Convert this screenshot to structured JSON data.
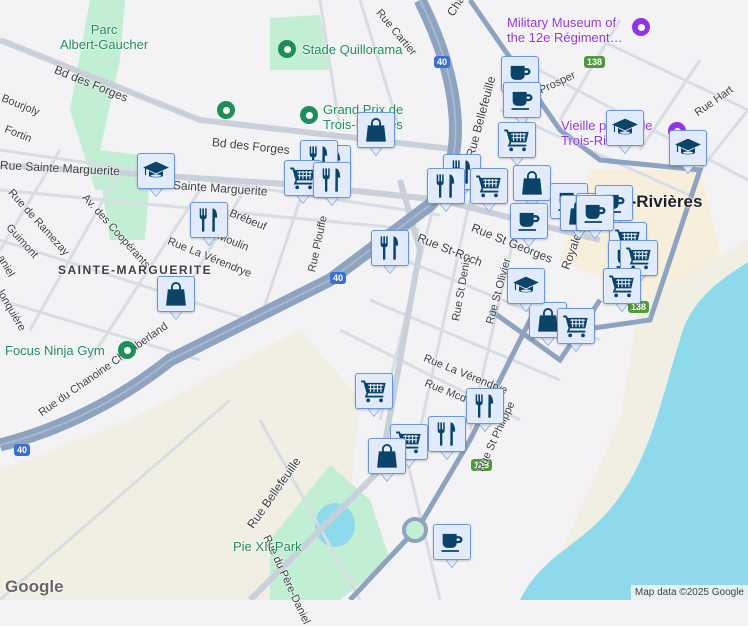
{
  "map": {
    "labels": {
      "parc_albert": "Parc\nAlbert-Gaucher",
      "stade": "Stade Quillorama",
      "grand_prix": "Grand Prix de\nTrois-Rivières",
      "military": "Military Museum of\nthe 12e Régiment…",
      "vieille": "Vieille prison de\nTrois-Rivières",
      "trois_rivieres": "Trois-Rivières",
      "sainte_marguerite": "SAINTE-MARGUERITE",
      "focus_ninja": "Focus Ninja Gym",
      "pie_xii": "Pie XII Park"
    },
    "streets": {
      "bd_forges_1": "Bd des Forges",
      "bd_forges_2": "Bd des Forges",
      "sainte_marguerite_1": "Rue Sainte Marguerite",
      "sainte_marguerite_2": "Sainte Marguerite",
      "bourjoly": "Bourjoly",
      "fortin": "Fortin",
      "ramezay": "Rue de Ramezay",
      "guimont": "Guimont",
      "cooperants": "Av. des Coopérants",
      "brebeuf": "Brébeuf",
      "moulin": "Moulin",
      "verendrye_1": "Rue La Vérendrye",
      "verendrye_2": "Rue La Vérendrye",
      "plouffe": "Rue Plouffe",
      "cartier": "Rue Cartier",
      "champflour": "Champflour",
      "bellefeuille_1": "Rue Bellefeuille",
      "bellefeuille_2": "Rue Bellefeuille",
      "prosper": "Prosper",
      "hart": "Rue Hart",
      "st_roch": "Rue St-Roch",
      "st_georges": "Rue St Georges",
      "st_denis": "Rue St Denis",
      "st_olivier": "Rue St Olivier",
      "royale": "Royale",
      "mcdougall": "Rue Mcd",
      "st_philippe": "Rue St Philippe",
      "chanoine": "Rue du Chanoine Chamberland",
      "pere_daniel": "Rue du Père-Daniel",
      "lonquiere": "lonquière",
      "daniel": "aniel"
    },
    "shields": {
      "hwy40": "40",
      "rte138": "138"
    }
  },
  "markers": [
    {
      "icon": "cafe-icon"
    },
    {
      "icon": "cafe-icon"
    },
    {
      "icon": "cart-icon"
    },
    {
      "icon": "restaurant-icon"
    },
    {
      "icon": "restaurant-icon"
    },
    {
      "icon": "cart-icon"
    },
    {
      "icon": "shop-icon"
    },
    {
      "icon": "cafe-icon"
    },
    {
      "icon": "shop-icon"
    },
    {
      "icon": "shop-icon"
    },
    {
      "icon": "cafe-icon"
    },
    {
      "icon": "cafe-icon"
    },
    {
      "icon": "cart-icon"
    },
    {
      "icon": "cafe-icon"
    },
    {
      "icon": "cart-icon"
    },
    {
      "icon": "cafe-icon"
    },
    {
      "icon": "graduation-cap-icon"
    },
    {
      "icon": "shop-icon"
    },
    {
      "icon": "cart-icon"
    },
    {
      "icon": "cart-icon"
    },
    {
      "icon": "graduation-cap-icon"
    },
    {
      "icon": "graduation-cap-icon"
    },
    {
      "icon": "shop-icon"
    },
    {
      "icon": "restaurant-icon"
    },
    {
      "icon": "restaurant-icon"
    },
    {
      "icon": "cart-icon"
    },
    {
      "icon": "restaurant-icon"
    },
    {
      "icon": "graduation-cap-icon"
    },
    {
      "icon": "restaurant-icon"
    },
    {
      "icon": "shop-icon"
    },
    {
      "icon": "restaurant-icon"
    },
    {
      "icon": "cart-icon"
    },
    {
      "icon": "restaurant-icon"
    },
    {
      "icon": "restaurant-icon"
    },
    {
      "icon": "cart-icon"
    },
    {
      "icon": "shop-icon"
    },
    {
      "icon": "cafe-icon"
    }
  ],
  "colors": {
    "water": "#8fd9ec",
    "park": "#c2efd4",
    "highway": "#8da3bf",
    "marker_icon": "#0b4468"
  },
  "footer": {
    "logo": "Google",
    "attribution": "Map data ©2025 Google"
  }
}
